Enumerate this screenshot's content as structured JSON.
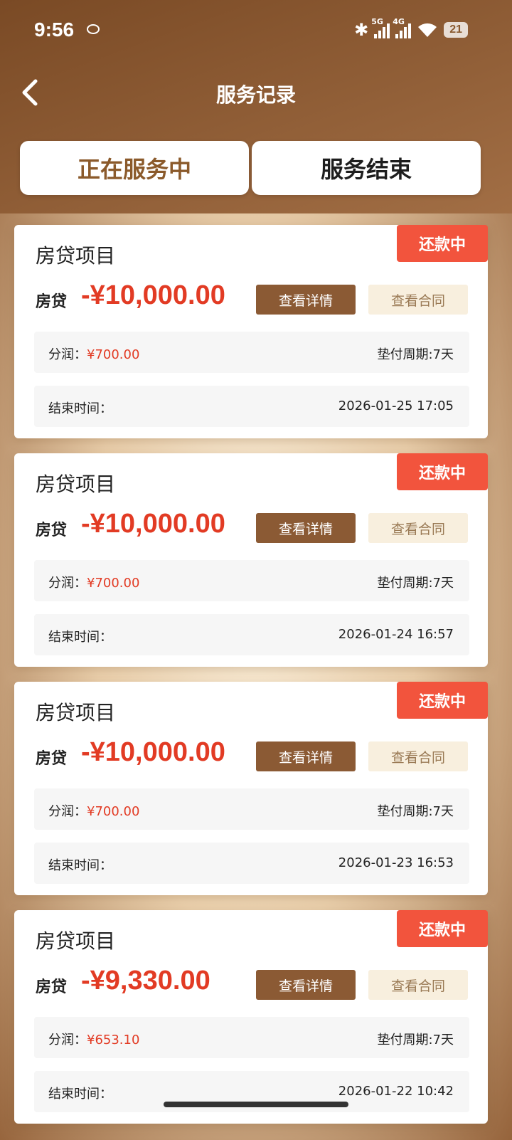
{
  "status_bar": {
    "time": "9:56",
    "net1": "5G",
    "net2": "4G",
    "battery": "21"
  },
  "header": {
    "title": "服务记录"
  },
  "tabs": [
    {
      "label": "正在服务中",
      "active": true
    },
    {
      "label": "服务结束",
      "active": false
    }
  ],
  "cards": [
    {
      "title": "房贷项目",
      "badge": "还款中",
      "loan_type": "房贷",
      "amount": "-¥10,000.00",
      "detail_btn": "查看详情",
      "contract_btn": "查看合同",
      "profit_label": "分润：",
      "profit": "¥700.00",
      "period": "垫付周期:7天",
      "end_label": "结束时间：",
      "end_time": "2026-01-25 17:05"
    },
    {
      "title": "房贷项目",
      "badge": "还款中",
      "loan_type": "房贷",
      "amount": "-¥10,000.00",
      "detail_btn": "查看详情",
      "contract_btn": "查看合同",
      "profit_label": "分润：",
      "profit": "¥700.00",
      "period": "垫付周期:7天",
      "end_label": "结束时间：",
      "end_time": "2026-01-24 16:57"
    },
    {
      "title": "房贷项目",
      "badge": "还款中",
      "loan_type": "房贷",
      "amount": "-¥10,000.00",
      "detail_btn": "查看详情",
      "contract_btn": "查看合同",
      "profit_label": "分润：",
      "profit": "¥700.00",
      "period": "垫付周期:7天",
      "end_label": "结束时间：",
      "end_time": "2026-01-23 16:53"
    },
    {
      "title": "房贷项目",
      "badge": "还款中",
      "loan_type": "房贷",
      "amount": "-¥9,330.00",
      "detail_btn": "查看详情",
      "contract_btn": "查看合同",
      "profit_label": "分润：",
      "profit": "¥653.10",
      "period": "垫付周期:7天",
      "end_label": "结束时间：",
      "end_time": "2026-01-22 10:42"
    }
  ],
  "colors": {
    "accent_brown": "#8b5a34",
    "badge_red": "#f2543d",
    "amount_red": "#e23b24"
  }
}
